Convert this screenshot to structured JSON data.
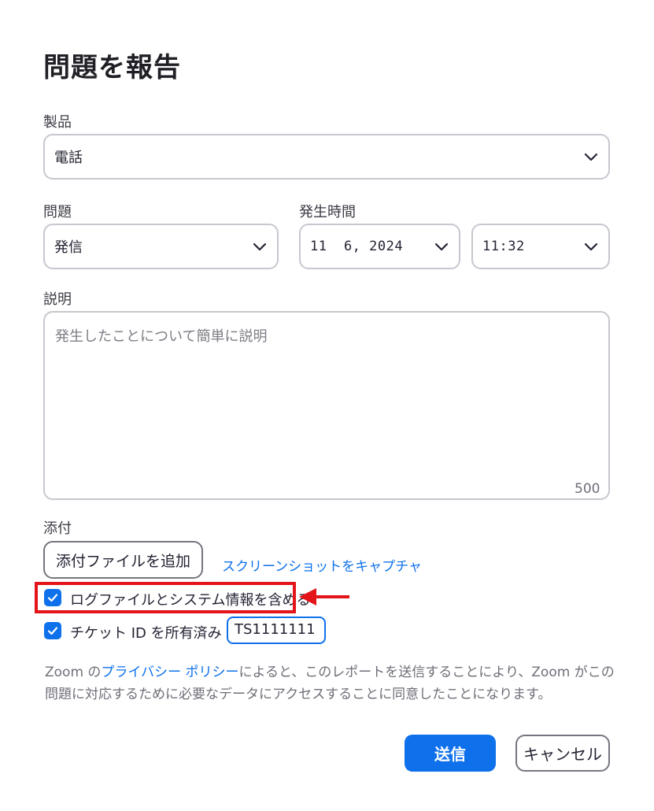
{
  "dialog": {
    "title": "問題を報告"
  },
  "product": {
    "label": "製品",
    "value": "電話"
  },
  "issue": {
    "label": "問題",
    "value": "発信"
  },
  "occurrence": {
    "label": "発生時間",
    "date": "11  6, 2024",
    "time": "11:32"
  },
  "description": {
    "label": "説明",
    "placeholder": "発生したことについて簡単に説明",
    "char_limit": "500"
  },
  "attachment": {
    "label": "添付",
    "add_button": "添付ファイルを追加",
    "capture_link": "スクリーンショットをキャプチャ"
  },
  "options": {
    "include_logs": {
      "label": "ログファイルとシステム情報を含める",
      "checked": true
    },
    "has_ticket": {
      "label": "チケット ID を所有済み",
      "checked": true,
      "ticket_value": "TS1111111"
    }
  },
  "privacy": {
    "prefix": "Zoom の",
    "link": "プライバシー ポリシー",
    "suffix": "によると、このレポートを送信することにより、Zoom がこの問題に対応するために必要なデータにアクセスすることに同意したことになります。"
  },
  "actions": {
    "send": "送信",
    "cancel": "キャンセル"
  },
  "colors": {
    "accent": "#0e71eb",
    "highlight": "#e3151a"
  },
  "icons": [
    "chevron-down-icon",
    "checkmark-icon",
    "red-arrow-icon"
  ]
}
